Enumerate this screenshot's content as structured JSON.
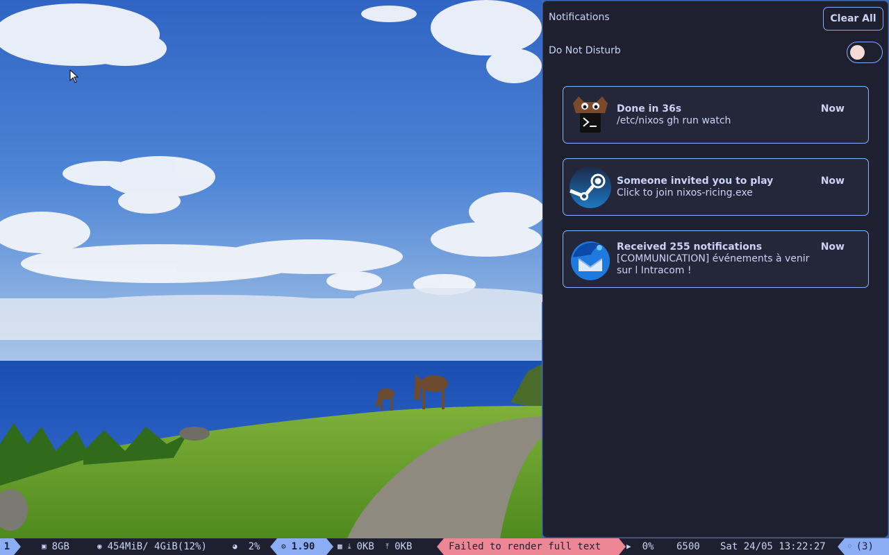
{
  "panel": {
    "title": "Notifications",
    "clear_all_label": "Clear All",
    "dnd_label": "Do Not Disturb",
    "dnd_enabled": false,
    "notifications": [
      {
        "app_icon": "terminal-cat-icon",
        "title": "Done in 36s",
        "body": "/etc/nixos gh run watch",
        "time": "Now"
      },
      {
        "app_icon": "steam-icon",
        "title": "Someone invited you to play",
        "body": "Click to join nixos-ricing.exe",
        "time": "Now"
      },
      {
        "app_icon": "thunderbird-icon",
        "title": "Received 255 notifications",
        "body": "[COMMUNICATION] événements à venir sur l Intracom !",
        "time": "Now"
      }
    ]
  },
  "bar": {
    "workspace": "1",
    "disk": "8GB",
    "memory": "454MiB/ 4GiB(12%)",
    "cpu": "2%",
    "load": "1.90",
    "net_down": "0KB",
    "net_up": "0KB",
    "window_title": "Failed to render full text",
    "volume": "0%",
    "color_temp": "6500",
    "clock": "Sat 24/05 13:22:27",
    "notification_count": "(3)"
  },
  "colors": {
    "panel_bg": "#1e2030",
    "card_bg": "#24273a",
    "accent": "#8aadf4",
    "text": "#cad3f5",
    "warning": "#ed8796",
    "toggle_knob": "#f4dbd6"
  }
}
